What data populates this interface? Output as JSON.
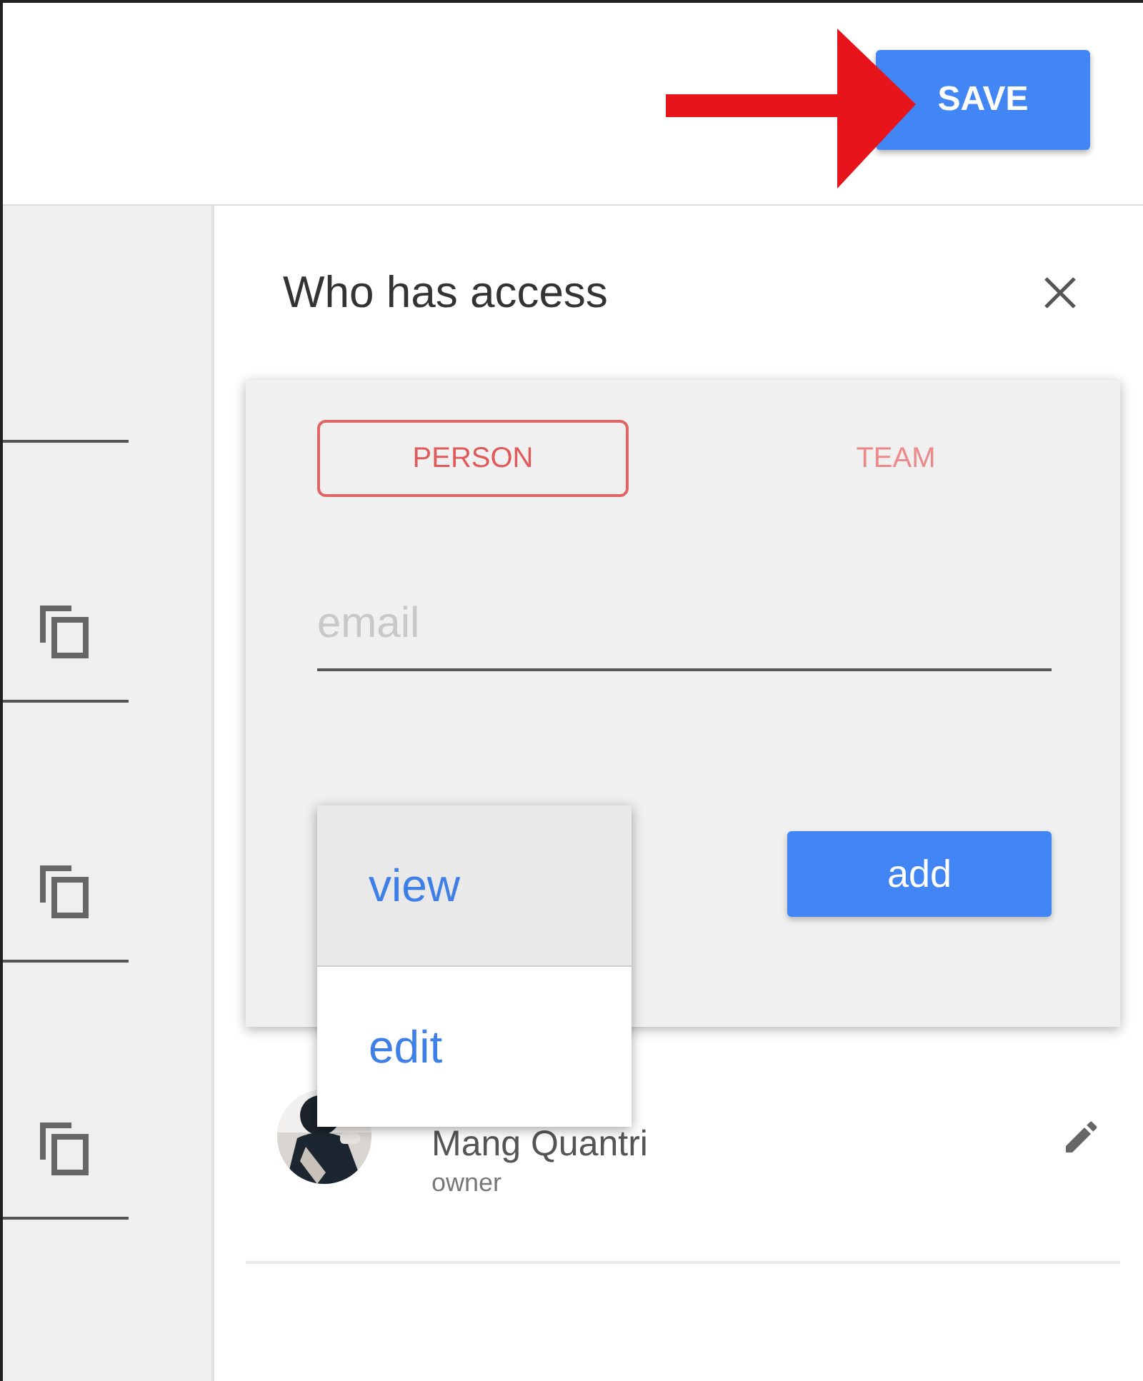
{
  "header": {
    "save_button": "SAVE"
  },
  "access_panel": {
    "title": "Who has access",
    "tabs": [
      {
        "label": "PERSON",
        "selected": true
      },
      {
        "label": "TEAM",
        "selected": false
      }
    ],
    "email_field": {
      "placeholder": "email"
    },
    "permission_menu": [
      {
        "label": "view",
        "selected": true
      },
      {
        "label": "edit",
        "selected": false
      }
    ],
    "add_button": "add",
    "members": [
      {
        "name": "Mang Quantri",
        "role": "owner"
      }
    ]
  }
}
